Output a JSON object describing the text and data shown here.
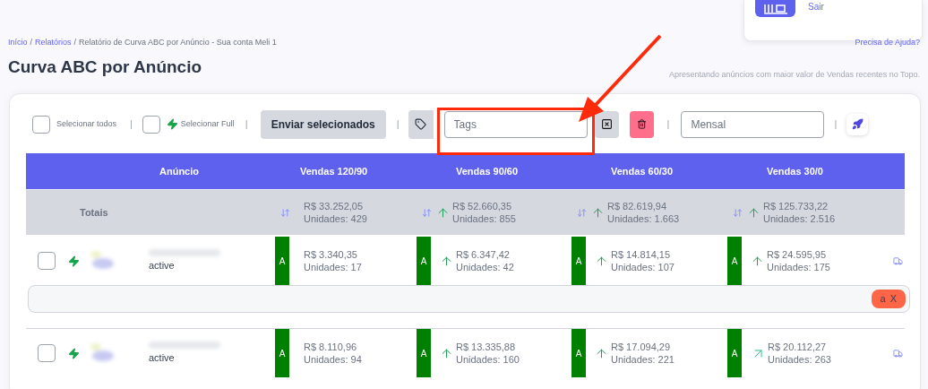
{
  "account_card": {
    "logout_link": "Sair"
  },
  "breadcrumb": {
    "separator": "/",
    "items": [
      {
        "label": "Início",
        "kind": "link"
      },
      {
        "label": "Relatórios",
        "kind": "link"
      },
      {
        "label": "Relatório de Curva ABC por Anúncio - Sua conta Meli 1",
        "kind": "current"
      }
    ]
  },
  "help_link": "Precisa de Ajuda?",
  "title": "Curva ABC por Anúncio",
  "subtitle": "Apresentando anúncios com maior valor de Vendas recentes no Topo.",
  "toolbar": {
    "separator": "|",
    "select_all": {
      "label": "Selecionar todos",
      "checked": false
    },
    "select_full": {
      "label": "Selecionar Full",
      "checked": false
    },
    "send_button": "Enviar selecionados",
    "tags_field": {
      "placeholder": "Tags"
    },
    "period_field": {
      "value": "Mensal"
    }
  },
  "table": {
    "columns": [
      "Anúncio",
      "Vendas 120/90",
      "Vendas 90/60",
      "Vendas 60/30",
      "Vendas 30/0"
    ],
    "totals": {
      "cells": [
        {
          "kind": "label",
          "text": "Totais"
        },
        {
          "kind": "sales",
          "value": "R$ 33.252,05",
          "units": "Unidades: 429"
        },
        {
          "kind": "sales",
          "trend": {
            "kind": "up"
          },
          "value": "R$ 52.660,35",
          "units": "Unidades: 855"
        },
        {
          "kind": "sales",
          "trend": {
            "kind": "up"
          },
          "value": "R$ 82.619,94",
          "units": "Unidades: 1.663"
        },
        {
          "kind": "sales",
          "trend": {
            "kind": "up"
          },
          "value": "R$ 125.733,22",
          "units": "Unidades: 2.516"
        }
      ]
    },
    "rows": [
      {
        "cells": [
          {
            "kind": "listing",
            "checked": false,
            "full": true,
            "status": "active"
          },
          {
            "kind": "sales",
            "grade": "A",
            "value": "R$ 3.340,35",
            "units": "Unidades: 17"
          },
          {
            "kind": "sales",
            "grade": "A",
            "trend": {
              "kind": "up"
            },
            "value": "R$ 6.347,42",
            "units": "Unidades: 42"
          },
          {
            "kind": "sales",
            "grade": "A",
            "trend": {
              "kind": "up"
            },
            "value": "R$ 14.814,15",
            "units": "Unidades: 107"
          },
          {
            "kind": "sales",
            "grade": "A",
            "trend": {
              "kind": "up"
            },
            "value": "R$ 24.595,95",
            "units": "Unidades: 175"
          }
        ],
        "tags": [
          {
            "label": "a",
            "remove": "X"
          }
        ]
      },
      {
        "cells": [
          {
            "kind": "listing",
            "checked": false,
            "full": true,
            "status": "active"
          },
          {
            "kind": "sales",
            "grade": "A",
            "value": "R$ 8.110,96",
            "units": "Unidades: 94"
          },
          {
            "kind": "sales",
            "grade": "A",
            "trend": {
              "kind": "up"
            },
            "value": "R$ 13.335,88",
            "units": "Unidades: 160"
          },
          {
            "kind": "sales",
            "grade": "A",
            "trend": {
              "kind": "up"
            },
            "value": "R$ 17.094,29",
            "units": "Unidades: 221"
          },
          {
            "kind": "sales",
            "grade": "A",
            "trend": {
              "kind": "up-right"
            },
            "value": "R$ 20.112,27",
            "units": "Unidades: 263"
          }
        ]
      }
    ]
  }
}
